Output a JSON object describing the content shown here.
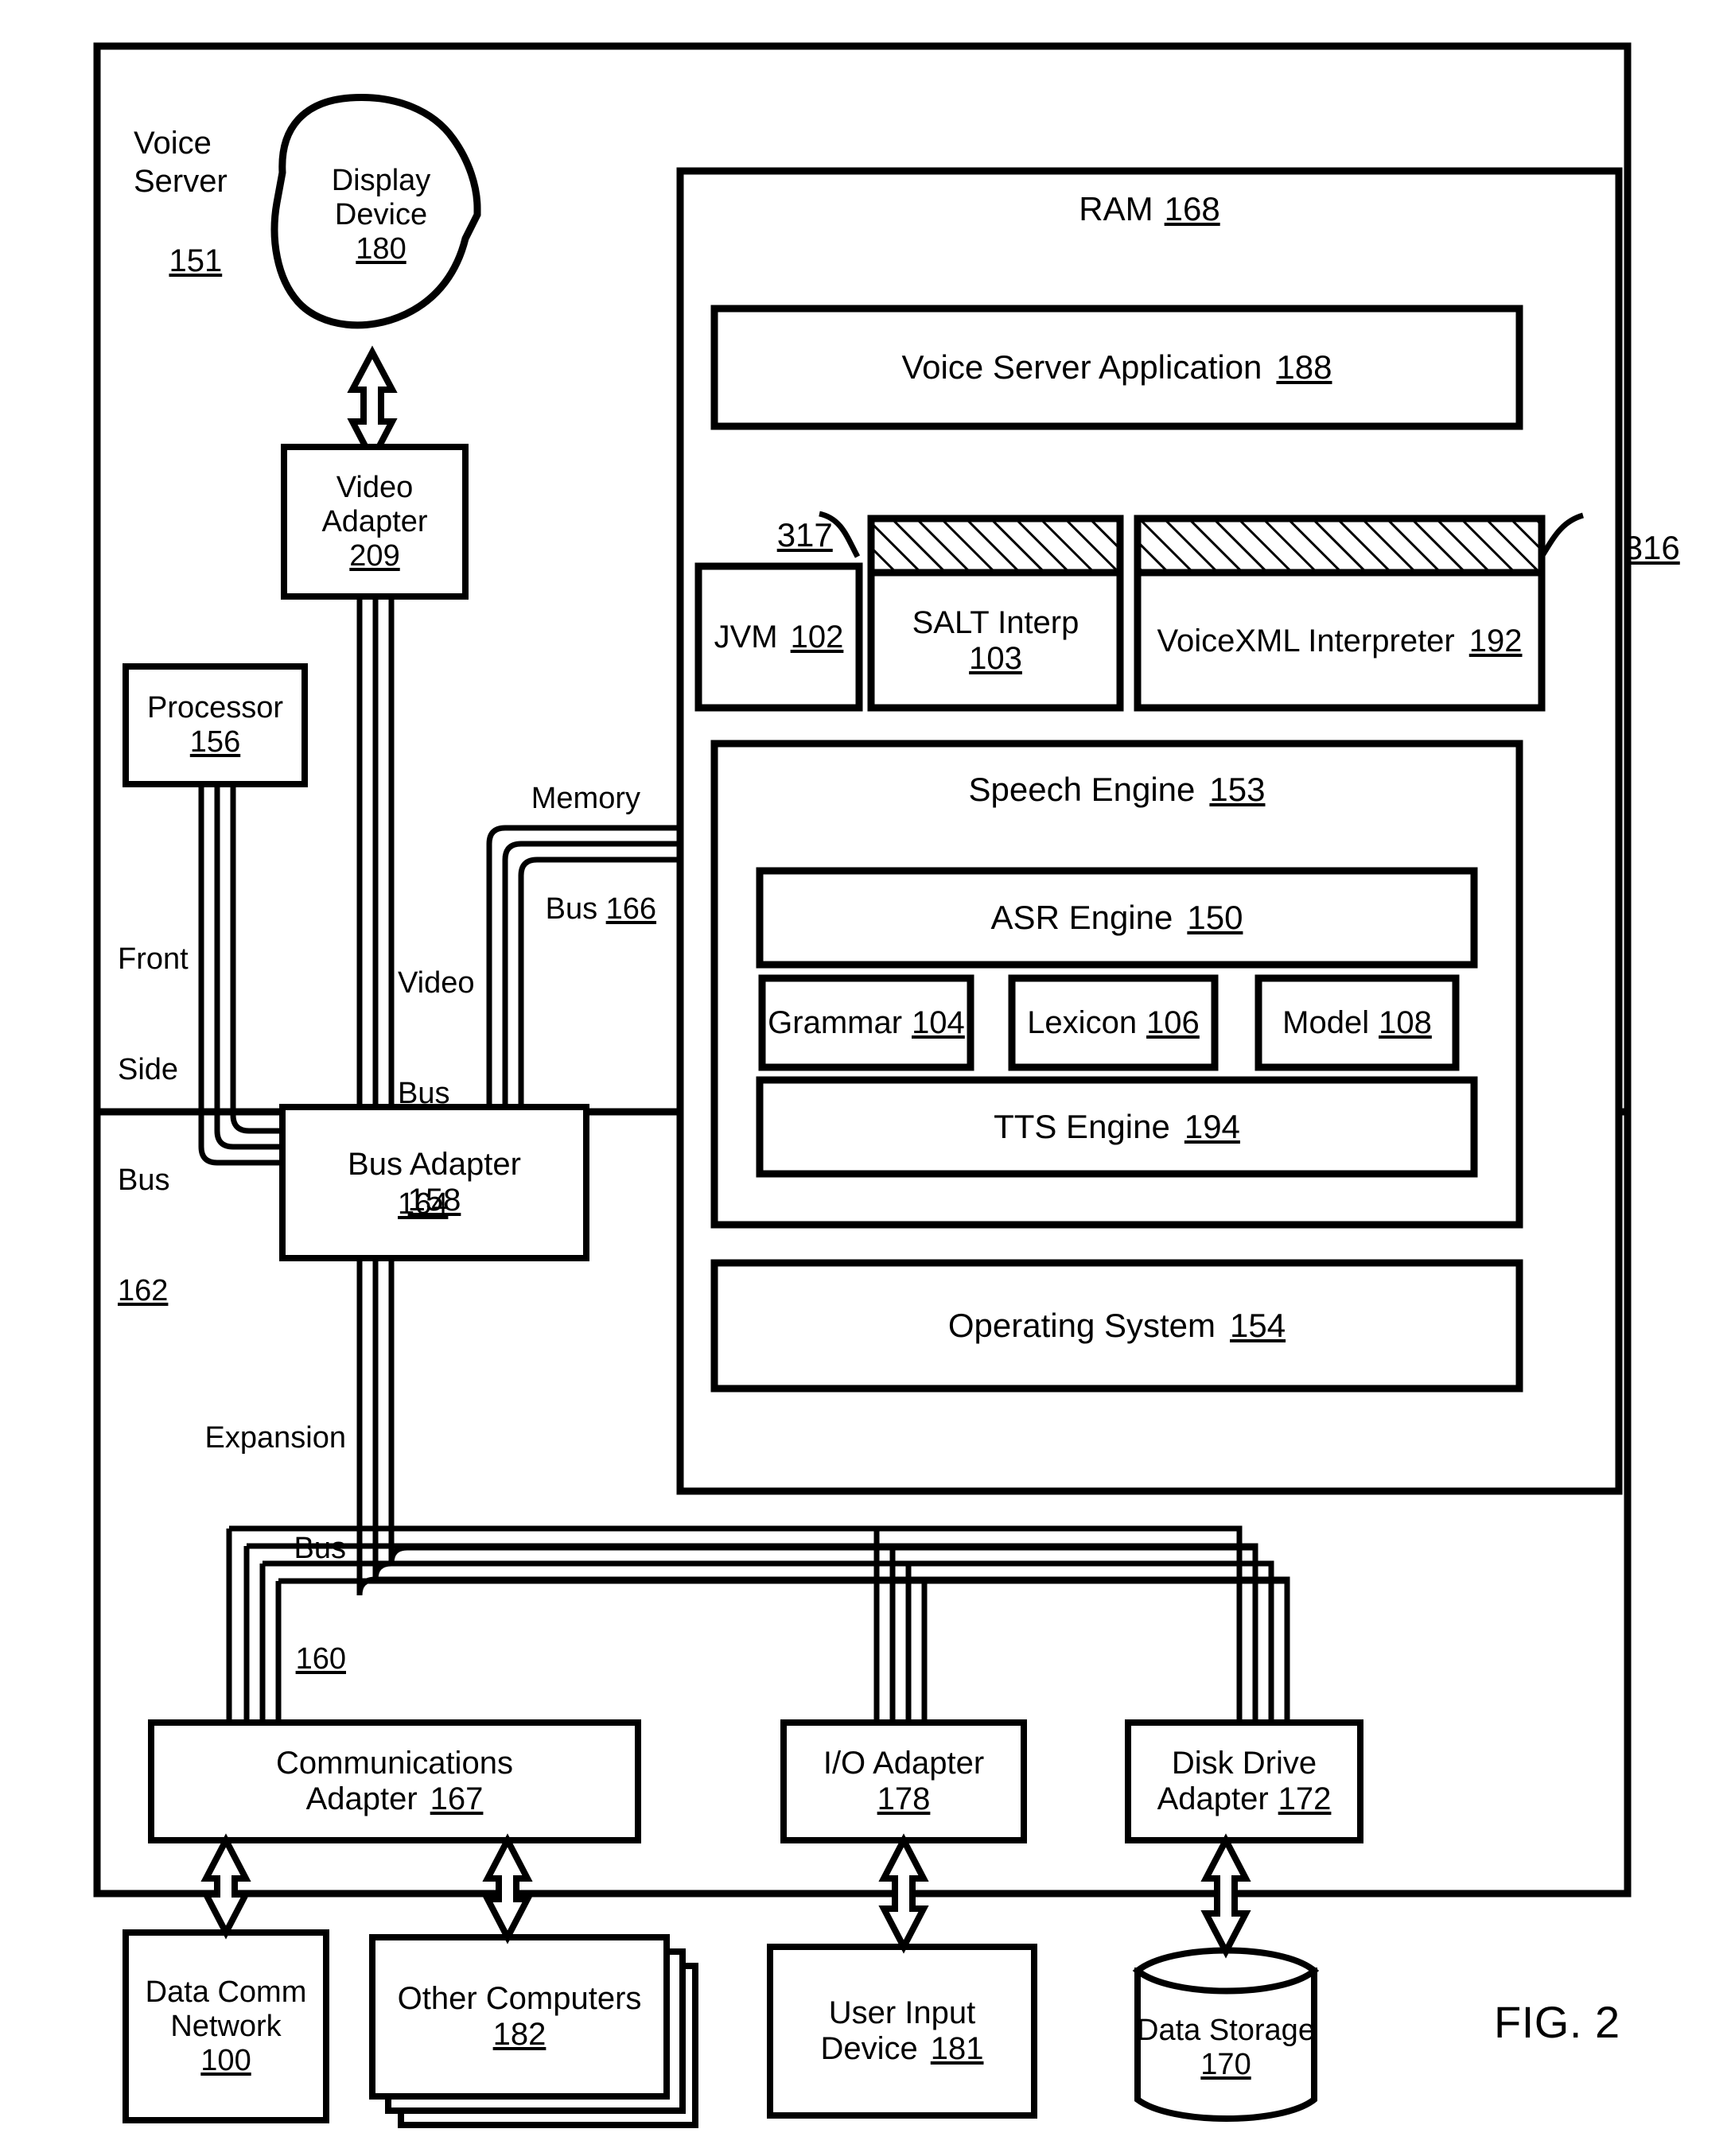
{
  "figure": {
    "caption": "FIG. 2",
    "outer_block": {
      "title": "Voice Server",
      "ref": "151"
    }
  },
  "nodes": {
    "display_device": {
      "line1": "Display",
      "line2": "Device",
      "ref": "180",
      "shape": "blob"
    },
    "video_adapter": {
      "line1": "Video",
      "line2": "Adapter",
      "ref": "209",
      "shape": "rect"
    },
    "processor": {
      "line1": "Processor",
      "ref": "156",
      "shape": "rect"
    },
    "bus_adapter": {
      "line1": "Bus Adapter",
      "ref": "158",
      "shape": "rect"
    },
    "ram": {
      "label": "RAM",
      "ref": "168",
      "shape": "rect"
    },
    "voice_server_app": {
      "label": "Voice Server Application",
      "ref": "188",
      "shape": "rect"
    },
    "jvm": {
      "label": "JVM",
      "ref": "102",
      "shape": "rect"
    },
    "salt_interp": {
      "label": "SALT Interp",
      "ref": "103",
      "shape": "rect-hatched-top"
    },
    "voicexml_interp": {
      "label": "VoiceXML Interpreter",
      "ref": "192",
      "shape": "rect-hatched-top"
    },
    "speech_engine": {
      "label": "Speech Engine",
      "ref": "153",
      "shape": "rect"
    },
    "asr_engine": {
      "label": "ASR Engine",
      "ref": "150",
      "shape": "rect"
    },
    "grammar": {
      "label": "Grammar",
      "ref": "104",
      "shape": "rect"
    },
    "lexicon": {
      "label": "Lexicon",
      "ref": "106",
      "shape": "rect"
    },
    "model": {
      "label": "Model",
      "ref": "108",
      "shape": "rect"
    },
    "tts_engine": {
      "label": "TTS Engine",
      "ref": "194",
      "shape": "rect"
    },
    "operating_system": {
      "label": "Operating System",
      "ref": "154",
      "shape": "rect"
    },
    "comm_adapter": {
      "line1": "Communications",
      "line2": "Adapter",
      "ref": "167",
      "shape": "rect"
    },
    "io_adapter": {
      "line1": "I/O Adapter",
      "ref": "178",
      "shape": "rect"
    },
    "disk_drive_adapter": {
      "line1": "Disk Drive",
      "line2": "Adapter",
      "ref": "172",
      "shape": "rect"
    },
    "data_comm_network": {
      "line1": "Data Comm",
      "line2": "Network",
      "ref": "100",
      "shape": "rect"
    },
    "other_computers": {
      "label": "Other Computers",
      "ref": "182",
      "shape": "stacked-rect"
    },
    "user_input_device": {
      "line1": "User Input",
      "line2": "Device",
      "ref": "181",
      "shape": "rect"
    },
    "data_storage": {
      "label": "Data Storage",
      "ref": "170",
      "shape": "cylinder"
    }
  },
  "buses": {
    "front_side_bus": {
      "line1": "Front",
      "line2": "Side",
      "line3": "Bus",
      "ref": "162"
    },
    "video_bus": {
      "line1": "Video",
      "line2": "Bus",
      "ref": "164"
    },
    "memory_bus": {
      "line1": "Memory",
      "line2": "Bus",
      "ref": "166"
    },
    "expansion_bus": {
      "line1": "Expansion",
      "line2": "Bus",
      "ref": "160"
    }
  },
  "callouts": {
    "salt_hatch": {
      "ref": "317"
    },
    "voicexml_hatch": {
      "ref": "316"
    }
  },
  "style": {
    "stroke": "#000000",
    "fill": "#ffffff"
  }
}
